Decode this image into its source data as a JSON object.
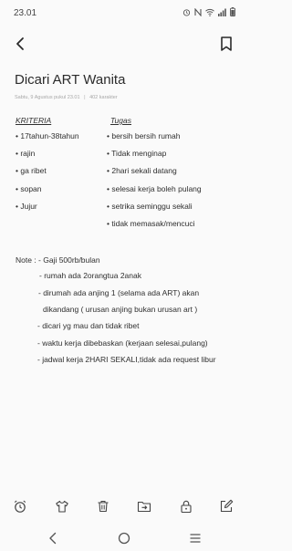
{
  "status_bar": {
    "time": "23.01",
    "icons": [
      "alarm-icon",
      "nfc-icon",
      "wifi-icon",
      "signal-icon",
      "battery-icon"
    ]
  },
  "note": {
    "title": "Dicari ART Wanita",
    "meta_date": "Sabtu, 9 Agustus pukul 23.01",
    "meta_separator": "|",
    "meta_chars": "402 karakter",
    "kriteria_header": "KRITERIA",
    "kriteria": [
      "• 17tahun-38tahun",
      "• rajin",
      "• ga ribet",
      "• sopan",
      "• Jujur"
    ],
    "tugas_header": "Tugas",
    "tugas": [
      "• bersih bersih rumah",
      "• Tidak menginap",
      "• 2hari sekali datang",
      "• selesai kerja boleh pulang",
      "• setrika seminggu sekali",
      "• tidak memasak/mencuci"
    ],
    "note_lines": [
      "Note : - Gaji 500rb/bulan",
      "- rumah ada 2orangtua 2anak",
      "- dirumah ada anjing 1 (selama ada ART) akan",
      "dikandang ( urusan anjing bukan urusan art )",
      "- dicari yg mau dan tidak ribet",
      "- waktu kerja dibebaskan (kerjaan selesai,pulang)",
      "- jadwal kerja 2HARI SEKALI,tidak ada request libur"
    ]
  },
  "toolbar_icons": [
    "alarm-icon",
    "shirt-icon",
    "trash-icon",
    "move-icon",
    "lock-icon",
    "edit-icon"
  ],
  "nav_icons": [
    "nav-back-icon",
    "nav-home-icon",
    "nav-recents-icon"
  ],
  "colors": {
    "background": "#fafafa",
    "text": "#2a2a2a",
    "meta": "#a7a7a7"
  }
}
